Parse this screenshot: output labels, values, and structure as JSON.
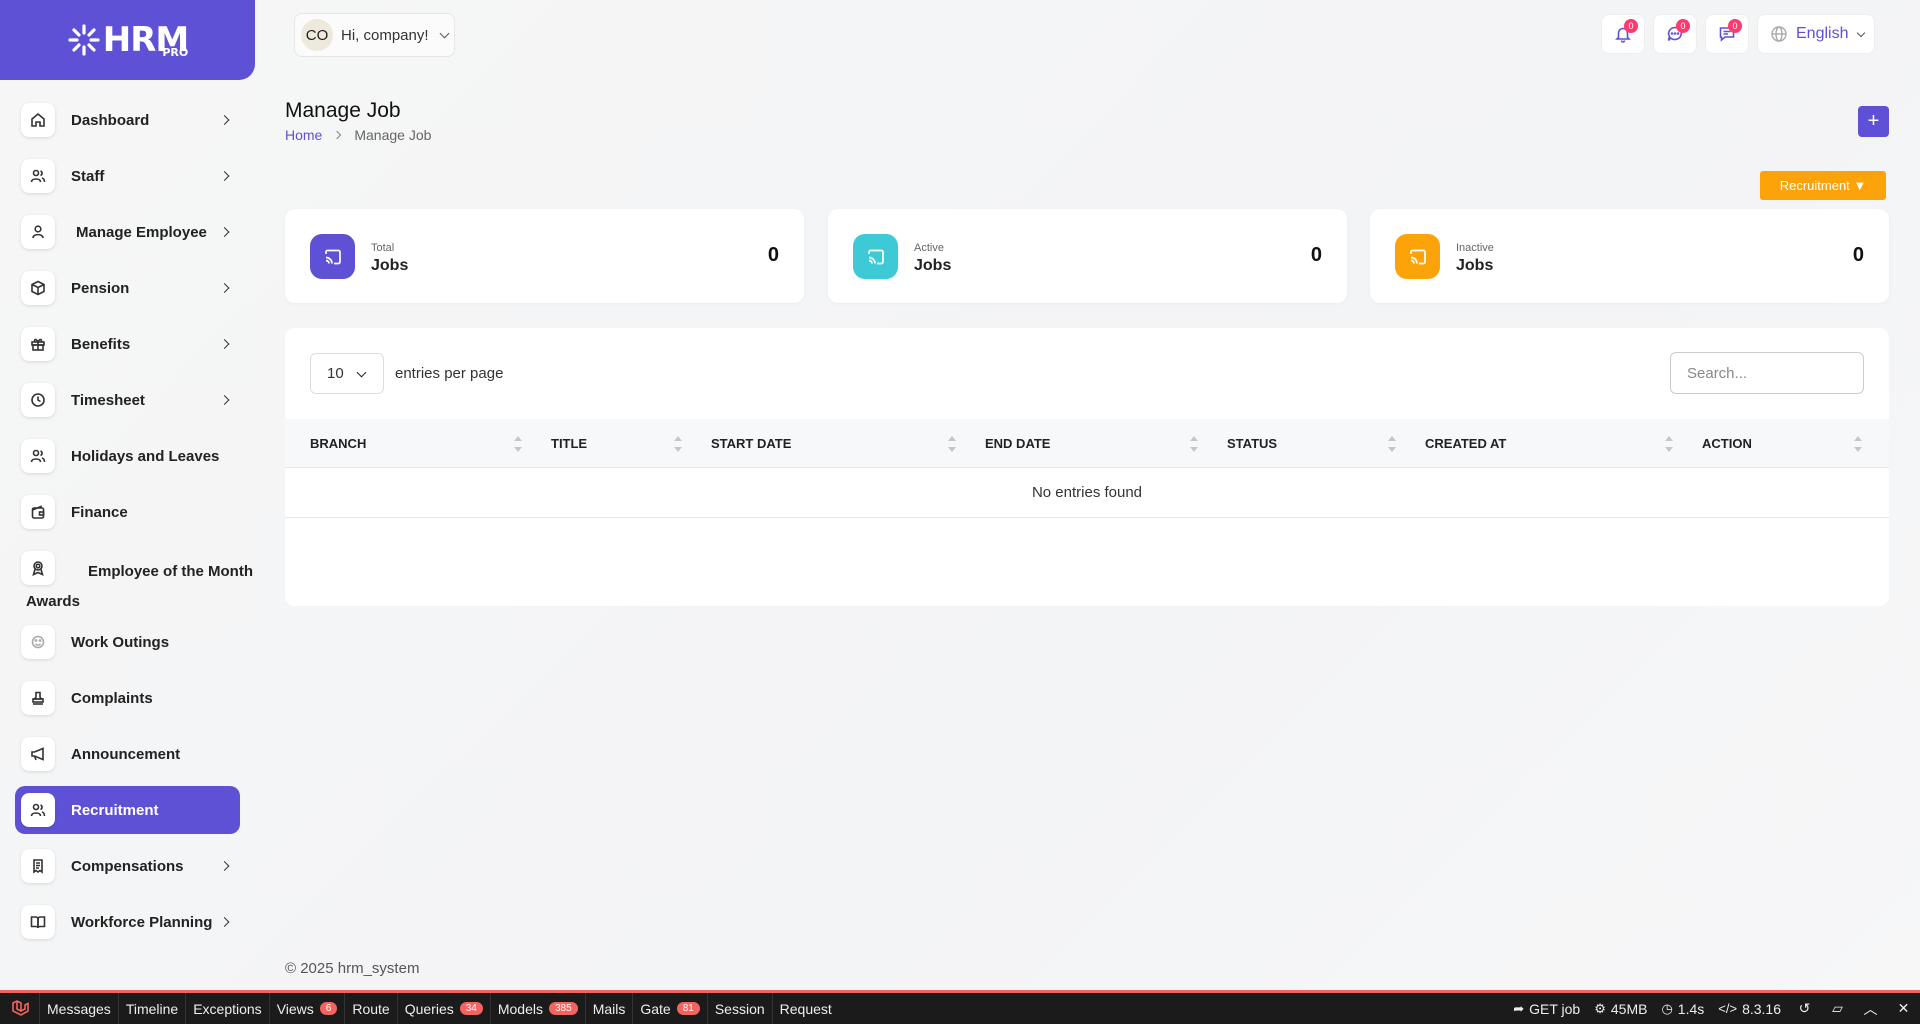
{
  "brand": {
    "logo_text": "HRM",
    "logo_sub": "PRO"
  },
  "header": {
    "avatar_initials": "CO",
    "greeting": "Hi, company!",
    "notifications": [
      {
        "icon": "bell-icon",
        "count": "0"
      },
      {
        "icon": "chat-icon",
        "count": "0"
      },
      {
        "icon": "message-icon",
        "count": "0"
      }
    ],
    "language": "English"
  },
  "sidebar": {
    "items": [
      {
        "label": "Dashboard",
        "icon": "home-icon",
        "has_submenu": true
      },
      {
        "label": "Staff",
        "icon": "users-icon",
        "has_submenu": true
      },
      {
        "label": "Manage Employee",
        "icon": "user-icon",
        "has_submenu": true
      },
      {
        "label": "Pension",
        "icon": "box-icon",
        "has_submenu": true
      },
      {
        "label": "Benefits",
        "icon": "gift-icon",
        "has_submenu": true
      },
      {
        "label": "Timesheet",
        "icon": "clock-icon",
        "has_submenu": true
      },
      {
        "label": "Holidays and Leaves",
        "icon": "users-icon",
        "has_submenu": false
      },
      {
        "label": "Finance",
        "icon": "wallet-icon",
        "has_submenu": false
      },
      {
        "label": "Employee of the Month",
        "label2": "Awards",
        "icon": "award-icon",
        "has_submenu": false
      },
      {
        "label": "Work Outings",
        "icon": "outing-icon",
        "has_submenu": false
      },
      {
        "label": "Complaints",
        "icon": "stamp-icon",
        "has_submenu": false
      },
      {
        "label": "Announcement",
        "icon": "megaphone-icon",
        "has_submenu": false
      },
      {
        "label": "Recruitment",
        "icon": "users-icon",
        "has_submenu": false,
        "active": true
      },
      {
        "label": "Compensations",
        "icon": "receipt-icon",
        "has_submenu": true
      },
      {
        "label": "Workforce Planning",
        "icon": "book-icon",
        "has_submenu": true
      }
    ]
  },
  "page": {
    "title": "Manage Job",
    "breadcrumb": {
      "home": "Home",
      "current": "Manage Job"
    },
    "add_button": "+",
    "recruitment_button": "Recruitment ▼"
  },
  "stats": [
    {
      "small": "Total",
      "big": "Jobs",
      "value": "0",
      "color": "#5e51d6"
    },
    {
      "small": "Active",
      "big": "Jobs",
      "value": "0",
      "color": "#3ec9d6"
    },
    {
      "small": "Inactive",
      "big": "Jobs",
      "value": "0",
      "color": "#fca30a"
    }
  ],
  "table": {
    "entries_value": "10",
    "entries_label": "entries per page",
    "search_placeholder": "Search...",
    "columns": [
      "BRANCH",
      "TITLE",
      "START DATE",
      "END DATE",
      "STATUS",
      "CREATED AT",
      "ACTION"
    ],
    "empty_message": "No entries found"
  },
  "footer": "© 2025 hrm_system",
  "debugbar": {
    "tabs": [
      {
        "label": "Messages"
      },
      {
        "label": "Timeline"
      },
      {
        "label": "Exceptions"
      },
      {
        "label": "Views",
        "badge": "6"
      },
      {
        "label": "Route"
      },
      {
        "label": "Queries",
        "badge": "34"
      },
      {
        "label": "Models",
        "badge": "385"
      },
      {
        "label": "Mails"
      },
      {
        "label": "Gate",
        "badge": "81"
      },
      {
        "label": "Session"
      },
      {
        "label": "Request"
      }
    ],
    "request": "GET job",
    "memory": "45MB",
    "time": "1.4s",
    "php_version": "8.3.16"
  }
}
